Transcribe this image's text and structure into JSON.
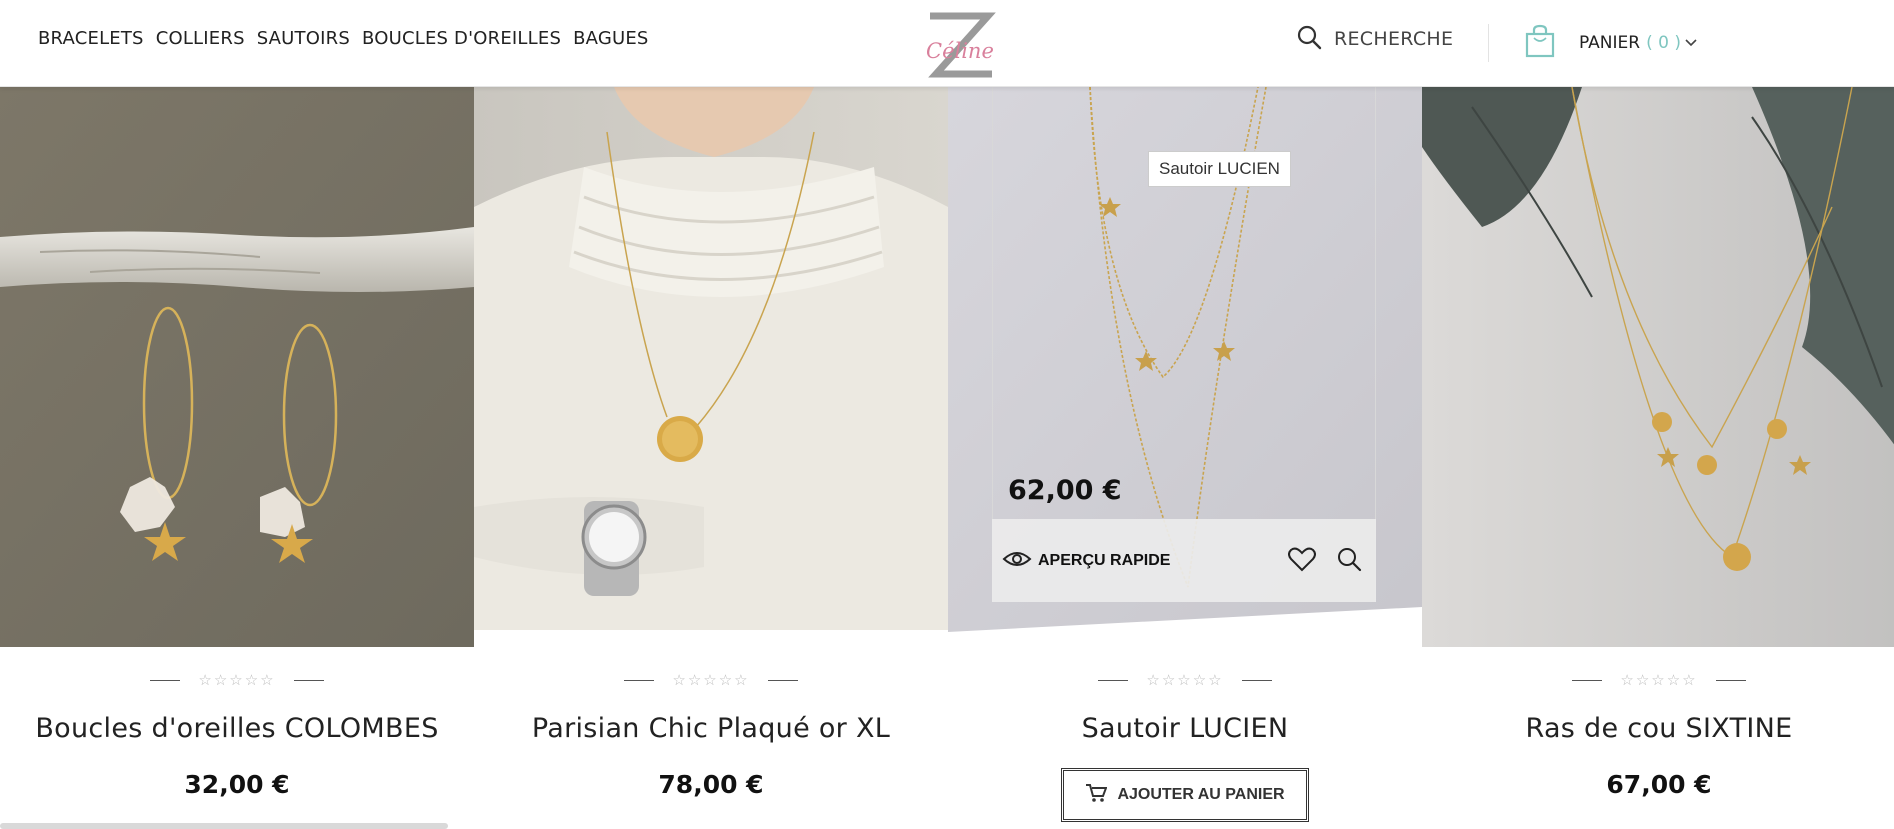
{
  "nav": {
    "items": [
      "BRACELETS",
      "COLLIERS",
      "SAUTOIRS",
      "BOUCLES D'OREILLES",
      "BAGUES"
    ]
  },
  "logo": {
    "letter": "Z",
    "script": "Céline",
    "accent": "#d9809c"
  },
  "search": {
    "label": "RECHERCHE",
    "icon": "search-icon"
  },
  "cart": {
    "label": "PANIER",
    "count": "( 0 )",
    "chevron": "⌄",
    "icon": "shopping-bag-icon",
    "accent": "#7fc6c0"
  },
  "products": [
    {
      "name": "Boucles d'oreilles COLOMBES",
      "price": "32,00 €",
      "stars": "☆☆☆☆☆"
    },
    {
      "name": "Parisian Chic Plaqué or XL",
      "price": "78,00 €",
      "stars": "☆☆☆☆☆"
    },
    {
      "name": "Sautoir LUCIEN",
      "price": "62,00 €",
      "stars": "☆☆☆☆☆"
    },
    {
      "name": "Ras de cou SIXTINE",
      "price": "67,00 €",
      "stars": "☆☆☆☆☆"
    }
  ],
  "hover": {
    "tooltip": "Sautoir LUCIEN",
    "price": "62,00 €",
    "quick_view": "APERÇU RAPIDE",
    "add_to_cart": "AJOUTER AU PANIER"
  }
}
